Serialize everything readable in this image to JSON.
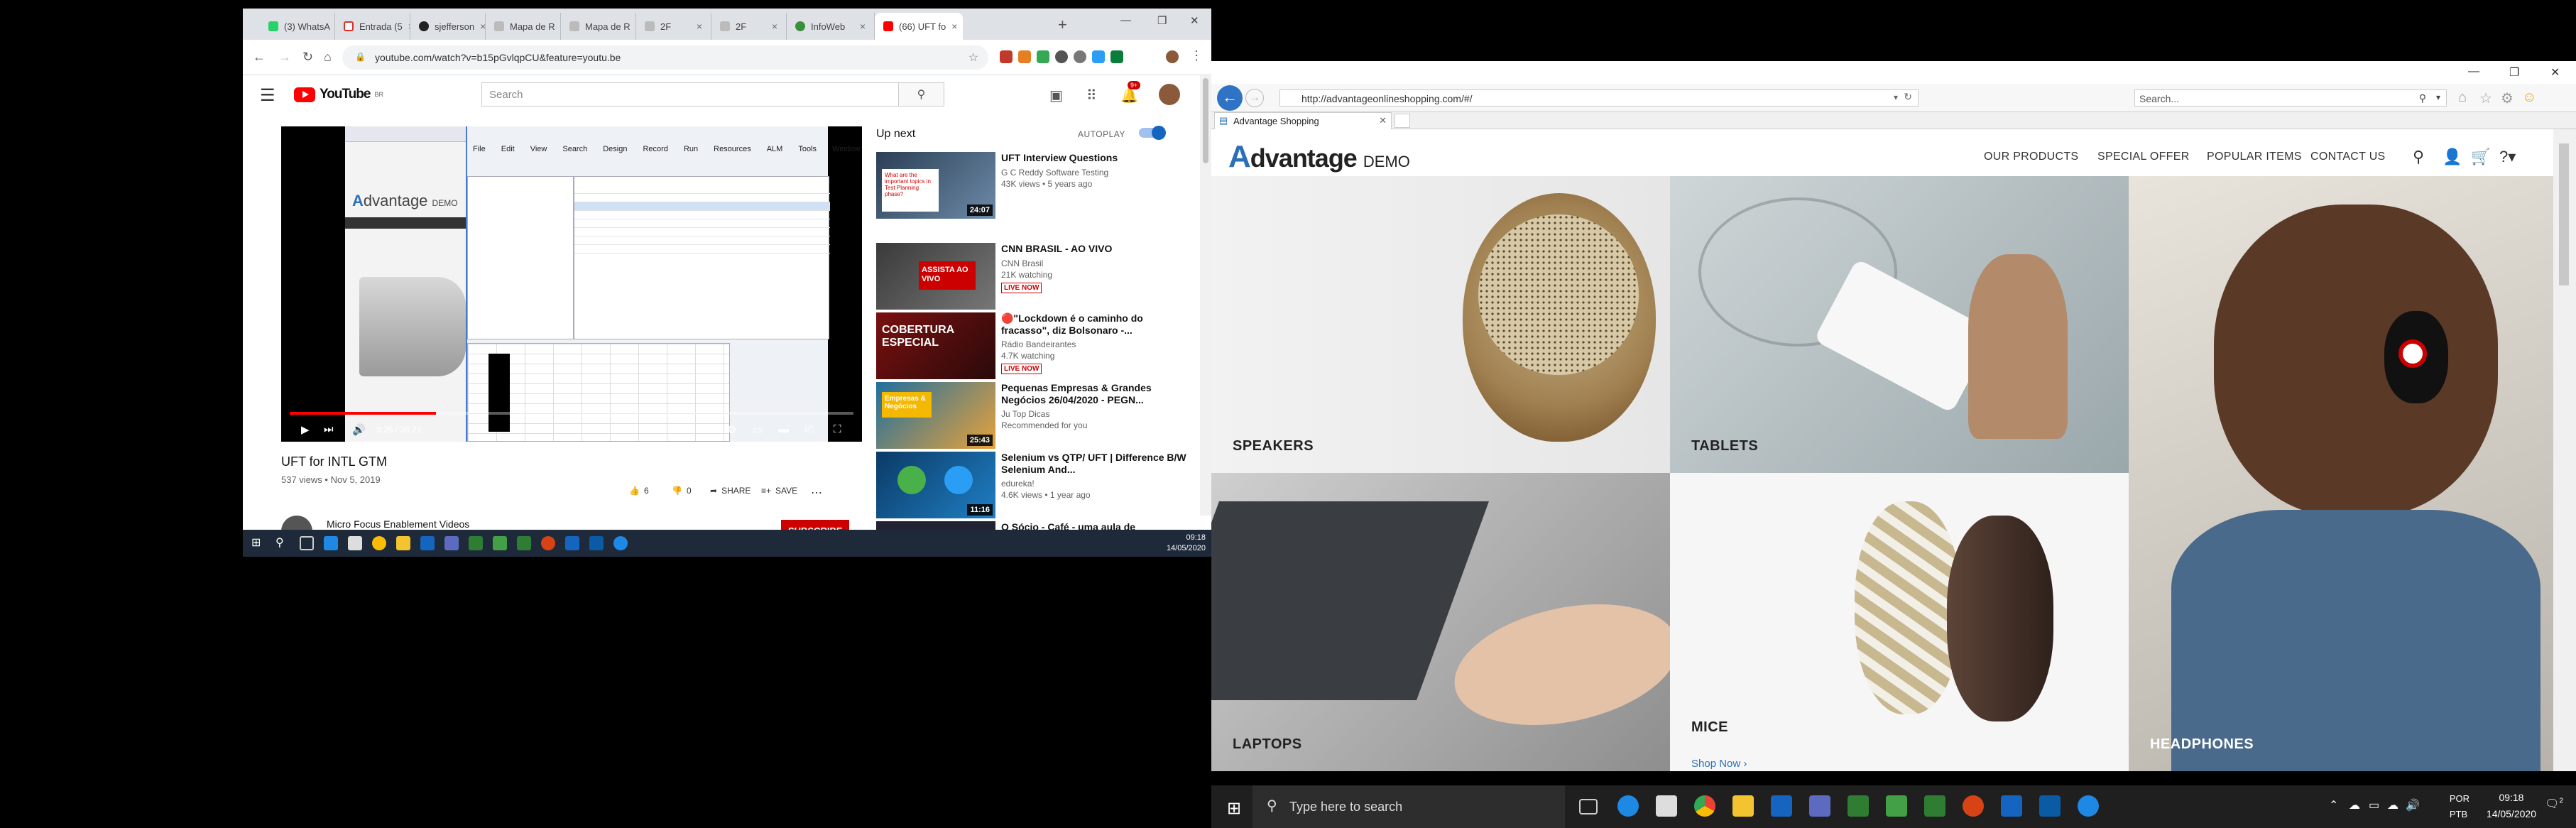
{
  "chrome": {
    "tabs": [
      "(3) WhatsA",
      "Entrada (5",
      "sjefferson",
      "Mapa de R",
      "Mapa de R",
      "2F",
      "2F",
      "InfoWeb",
      "(66) UFT fo"
    ],
    "url": "youtube.com/watch?v=b15pGvlqpCU&feature=youtu.be",
    "new_tab": "+"
  },
  "youtube": {
    "logo": "YouTube",
    "logo_sup": "BR",
    "search_placeholder": "Search",
    "notif_count": "9+",
    "player": {
      "time": "9:26 / 36:21",
      "progress": 0.26,
      "embedded_logo_a": "A",
      "embedded_logo_rest": "dvantage",
      "embedded_logo_demo": "DEMO",
      "uft_menu": [
        "File",
        "Edit",
        "View",
        "Search",
        "Design",
        "Record",
        "Run",
        "Resources",
        "ALM",
        "Tools",
        "Window"
      ]
    },
    "video_title": "UFT for INTL GTM",
    "video_meta": "537 views • Nov 5, 2019",
    "likes": "6",
    "dislikes": "0",
    "share": "SHARE",
    "save": "SAVE",
    "channel": "Micro Focus Enablement Videos",
    "subscribe": "SUBSCRIBE",
    "up_next": "Up next",
    "autoplay": "AUTOPLAY",
    "recs": [
      {
        "title": "UFT Interview Questions",
        "channel": "G C Reddy Software Testing",
        "meta": "43K views • 5 years ago",
        "dur": "24:07"
      },
      {
        "title": "CNN BRASIL - AO VIVO",
        "channel": "CNN Brasil",
        "meta": "21K watching",
        "live": "LIVE NOW"
      },
      {
        "title": "🔴\"Lockdown é o caminho do fracasso\", diz Bolsonaro -...",
        "channel": "Rádio Bandeirantes",
        "meta": "4.7K watching",
        "live": "LIVE NOW"
      },
      {
        "title": "Pequenas Empresas & Grandes Negócios 26/04/2020 - PEGN...",
        "channel": "Ju Top Dicas",
        "meta": "Recommended for you",
        "dur": "25:43"
      },
      {
        "title": "Selenium vs QTP/ UFT | Difference B/W Selenium And...",
        "channel": "edureka!",
        "meta": "4.6K views • 1 year ago",
        "dur": "11:16"
      },
      {
        "title": "O Sócio - Café - uma aula de"
      }
    ]
  },
  "left_taskbar": {
    "time": "09:18",
    "date": "14/05/2020"
  },
  "ie": {
    "url": "http://advantageonlineshopping.com/#/",
    "search": "Search...",
    "tab_title": "Advantage Shopping"
  },
  "site": {
    "logo_a": "A",
    "logo_rest": "dvantage",
    "logo_demo": "DEMO",
    "nav": [
      "OUR PRODUCTS",
      "SPECIAL OFFER",
      "POPULAR ITEMS",
      "CONTACT US"
    ],
    "categories": [
      "SPEAKERS",
      "TABLETS",
      "HEADPHONES",
      "LAPTOPS",
      "MICE"
    ],
    "shop_now": "Shop Now"
  },
  "taskbar": {
    "search": "Type here to search",
    "time": "09:18",
    "date": "14/05/2020",
    "lang1": "POR",
    "lang2": "PTB",
    "notif": "2"
  }
}
